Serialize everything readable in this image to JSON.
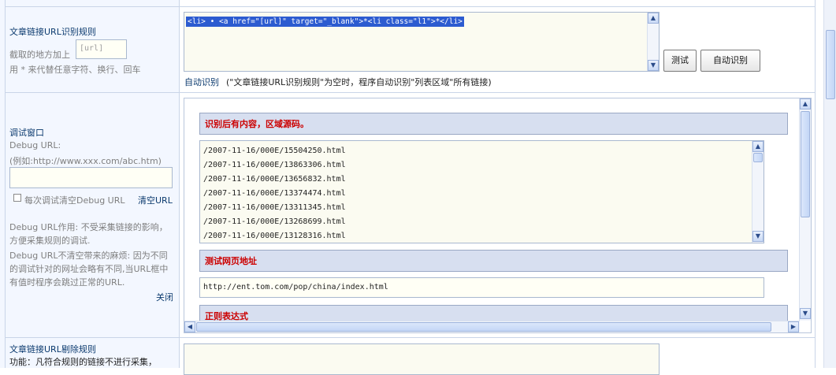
{
  "section1": {
    "title": "文章链接URL识别规则",
    "prefix_label": "截取的地方加上",
    "placeholder_value": "[url]",
    "hint": "用 * 来代替任意字符、换行、回车",
    "rule_text": "<li> • <a href=\"[url]\" target=\"_blank\">*<li class=\"l1\">*</li>",
    "test_button": "测试",
    "auto_button": "自动识别",
    "auto_link": "自动识别",
    "auto_note": "(\"文章链接URL识别规则\"为空时，程序自动识别\"列表区域\"所有链接)"
  },
  "section2": {
    "title": "调试窗口",
    "debug_url_label": "Debug URL:",
    "debug_url_example": "(例如:http://www.xxx.com/abc.htm)",
    "debug_url_value": "",
    "checkbox_label": "每次调试清空Debug URL",
    "clear_link": "清空URL",
    "note1": "Debug URL作用: 不受采集链接的影响，方便采集规则的调试.",
    "note2": "Debug URL不清空带来的麻烦: 因为不同的调试针对的网址会略有不同,当URL框中有值时程序会跳过正常的URL.",
    "close_link": "关闭",
    "panel": {
      "header1": "识别后有内容，区域源码。",
      "urls": [
        "/2007-11-16/000E/15504250.html",
        "/2007-11-16/000E/13863306.html",
        "/2007-11-16/000E/13656832.html",
        "/2007-11-16/000E/13374474.html",
        "/2007-11-16/000E/13311345.html",
        "/2007-11-16/000E/13268699.html",
        "/2007-11-16/000E/13128316.html"
      ],
      "header2": "测试网页地址",
      "test_url": "http://ent.tom.com/pop/china/index.html",
      "header3": "正则表达式"
    }
  },
  "section3": {
    "title": "文章链接URL剔除规则",
    "hint": "功能：凡符合规则的链接不进行采集，"
  }
}
